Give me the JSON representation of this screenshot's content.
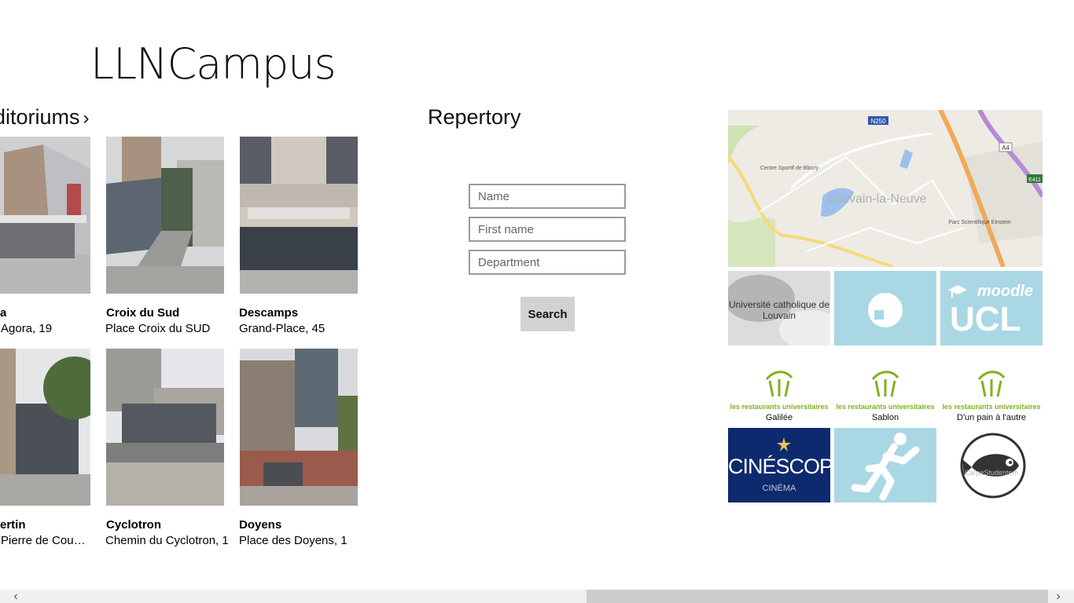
{
  "app": {
    "title": "LLNCampus"
  },
  "auditoriums": {
    "header": "ditoriums",
    "items": [
      {
        "name": "a",
        "address": "Agora, 19"
      },
      {
        "name": "Croix du Sud",
        "address": "Place Croix du SUD"
      },
      {
        "name": "Descamps",
        "address": "Grand-Place, 45"
      },
      {
        "name": "ertin",
        "address": "Pierre de Coubertin"
      },
      {
        "name": "Cyclotron",
        "address": "Chemin du Cyclotron, 1"
      },
      {
        "name": "Doyens",
        "address": "Place des Doyens, 1"
      }
    ]
  },
  "repertory": {
    "header": "Repertory",
    "name_placeholder": "Name",
    "firstname_placeholder": "First name",
    "department_placeholder": "Department",
    "search_label": "Search"
  },
  "links": {
    "map_labels": {
      "road_n250": "N250",
      "road_a4": "A4",
      "road_e411": "E411",
      "town": "Louvain-la-Neuve",
      "sport": "Centre Sportif de Blocry",
      "park": "Parc Scientifique Einstein"
    },
    "ucl_text": "Université catholique de Louvain",
    "moodle_text": "moodle",
    "moodle_ucl": "UCL",
    "resto_brand": "les restaurants universitaires",
    "restos": [
      "Galilée",
      "Sablon",
      "D'un pain à l'autre"
    ],
    "cinescope": "CINÉSCOPE",
    "cinema": "CINÉMA",
    "carpe": "CarpeStudentem"
  },
  "colors": {
    "tile_blue": "#aad7e4",
    "cinescope_bg": "#0e2a6e",
    "resto_green": "#7fb21c",
    "scroll_thumb": "#cdcdcd"
  },
  "scrollbar": {
    "position": 0.55
  }
}
